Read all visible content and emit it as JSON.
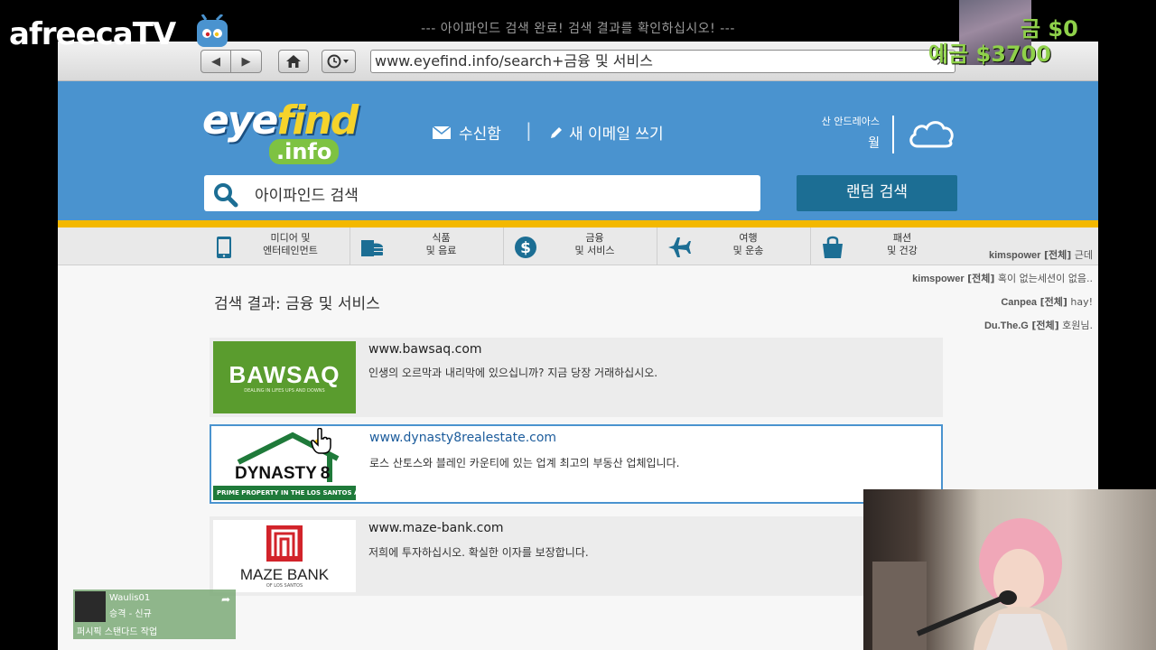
{
  "browser": {
    "title": "--- 아이파인드 검색 완료! 검색 결과를 확인하십시오! ---",
    "url": "www.eyefind.info/search+금융 및 서비스",
    "clear_icon": "close-icon",
    "back_icon": "arrow-left-icon",
    "forward_icon": "arrow-right-icon",
    "home_icon": "home-icon",
    "history_icon": "clock-icon"
  },
  "header": {
    "logo_eye": "eye",
    "logo_find": "find",
    "logo_info": ".info",
    "inbox_label": "수신함",
    "separator": "|",
    "compose_label": "새 이메일 쓰기",
    "weather_location": "산 안드레아스",
    "weather_day": "월",
    "search_placeholder": "아이파인드 검색",
    "random_search_label": "랜덤 검색"
  },
  "categories": [
    {
      "line1": "미디어 및",
      "line2": "엔터테인먼트",
      "icon": "tablet-icon"
    },
    {
      "line1": "식품",
      "line2": "및 음료",
      "icon": "food-icon"
    },
    {
      "line1": "금융",
      "line2": "및 서비스",
      "icon": "dollar-icon"
    },
    {
      "line1": "여행",
      "line2": "및 운송",
      "icon": "airplane-icon"
    },
    {
      "line1": "패션",
      "line2": "및 건강",
      "icon": "shopping-bag-icon"
    }
  ],
  "results": {
    "title": "검색 결과: 금융 및 서비스",
    "items": [
      {
        "url": "www.bawsaq.com",
        "desc": "인생의 오르막과 내리막에 있으십니까? 지금 당장 거래하십시오.",
        "logo_text": "BAWSAQ",
        "logo_sub": "DEALING IN LIFES UPS AND DOWNS"
      },
      {
        "url": "www.dynasty8realestate.com",
        "desc": "로스 산토스와 블레인 카운티에 있는 업계 최고의 부동산 업체입니다.",
        "logo_text": "DYNASTY",
        "logo_num": "8",
        "logo_sub": "PRIME PROPERTY IN THE LOS SANTOS AREA"
      },
      {
        "url": "www.maze-bank.com",
        "desc": "저희에 투자하십시오. 확실한 이자를 보장합니다.",
        "logo_text": "MAZE BANK",
        "logo_sub": "OF LOS SANTOS"
      }
    ]
  },
  "overlay": {
    "stream_logo": "afreecaTV",
    "cash": "금 $0",
    "bank": "예금 $3700",
    "chat": [
      {
        "user": "kimspower",
        "tag": "[전체]",
        "msg": "근데"
      },
      {
        "user": "kimspower",
        "tag": "[전체]",
        "msg": "혹이 없는세션이 없음.."
      },
      {
        "user": "Canpea",
        "tag": "[전체]",
        "msg": "hay!"
      },
      {
        "user": "Du.The.G",
        "tag": "[전체]",
        "msg": "호원님."
      }
    ],
    "notification": {
      "name": "Waulis01",
      "role": "승격 - 신규",
      "title": "퍼시픽 스탠다드 작업"
    }
  },
  "colors": {
    "header_blue": "#4a93cf",
    "stripe_yellow": "#f3b800",
    "random_btn": "#1c6e94",
    "money_green": "#8fd14a"
  }
}
